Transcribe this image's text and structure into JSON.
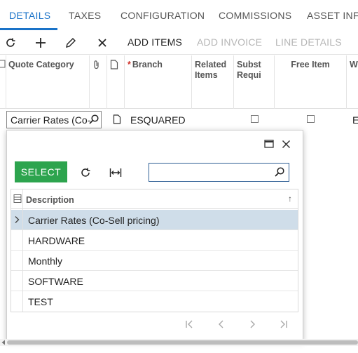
{
  "tabs": [
    {
      "label": "DETAILS",
      "active": true
    },
    {
      "label": "TAXES"
    },
    {
      "label": "CONFIGURATION"
    },
    {
      "label": "COMMISSIONS"
    },
    {
      "label": "ASSET INFO"
    }
  ],
  "toolbar": {
    "add_items": "ADD ITEMS",
    "add_invoice": "ADD INVOICE",
    "line_details": "LINE DETAILS"
  },
  "grid": {
    "headers": {
      "quote_category": "Quote Category",
      "branch_required": "*",
      "branch": "Branch",
      "related_items": "Related Items",
      "subst_required": "Subst Requi",
      "free_item": "Free Item",
      "warehouse": "W"
    },
    "row": {
      "quote_category": "Carrier Rates (Co-",
      "branch": "ESQUARED",
      "warehouse": "E"
    }
  },
  "popup": {
    "select_label": "SELECT",
    "search_value": "",
    "column_header": "Description",
    "sort_indicator": "↑",
    "items": [
      {
        "label": "Carrier Rates (Co-Sell pricing)",
        "selected": true
      },
      {
        "label": "HARDWARE"
      },
      {
        "label": "Monthly"
      },
      {
        "label": "SOFTWARE"
      },
      {
        "label": "TEST"
      }
    ]
  },
  "colors": {
    "accent": "#1a73c8",
    "select_button": "#2da44e",
    "selected_row": "#cfdde9"
  }
}
